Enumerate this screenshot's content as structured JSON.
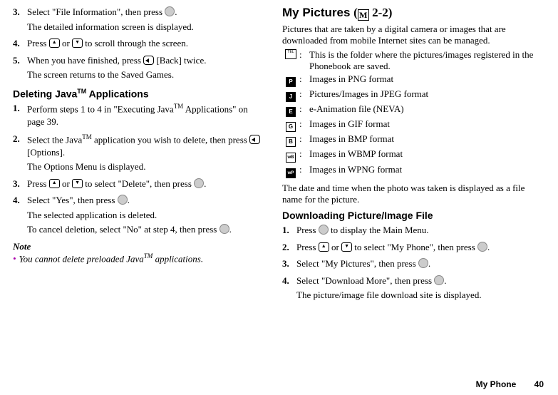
{
  "left": {
    "steps1": [
      {
        "n": "3.",
        "l1": "Select \"File Information\", then press ",
        "after": ".",
        "l2": "The detailed information screen is displayed."
      },
      {
        "n": "4.",
        "l1": "Press ",
        "mid": " or ",
        "after": " to scroll through the screen."
      },
      {
        "n": "5.",
        "l1": "When you have finished, press ",
        "after": " [Back] twice.",
        "l2": "The screen returns to the Saved Games."
      }
    ],
    "h2_1_prefix": "Deleting Java",
    "h2_1_tm": "TM",
    "h2_1_suffix": " Applications",
    "steps2": [
      {
        "n": "1.",
        "plain": "Perform steps 1 to 4 in \"Executing Java",
        "tm": "TM",
        "plain2": " Applications\" on page 39."
      },
      {
        "n": "2.",
        "l1": "Select the Java",
        "tm": "TM",
        "l1b": " application you wish to delete, then press ",
        "after": " [Options].",
        "l2": "The Options Menu is displayed."
      },
      {
        "n": "3.",
        "l1": "Press ",
        "mid": " or ",
        "l1b": " to select \"Delete\", then press ",
        "after": "."
      },
      {
        "n": "4.",
        "l1": "Select \"Yes\", then press ",
        "after": ".",
        "l2": "The selected application is deleted.",
        "l3": "To cancel deletion, select \"No\" at step 4, then press ",
        "after2": "."
      }
    ],
    "note_head": "Note",
    "note_line_pre": "You cannot delete preloaded Java",
    "note_tm": "TM",
    "note_line_post": " applications."
  },
  "right": {
    "h1": "My Pictures",
    "mbox": "M",
    "mcode": " 2-2)",
    "intro": "Pictures that are taken by a digital camera or images that are downloaded from mobile Internet sites can be managed.",
    "formats": [
      {
        "icon": "TEL",
        "desc": "This is the folder where the pictures/images registered in the Phonebook are saved."
      },
      {
        "icon": "P",
        "desc": "Images in PNG format"
      },
      {
        "icon": "J",
        "desc": "Pictures/Images in JPEG format"
      },
      {
        "icon": "E",
        "desc": "e-Animation file (NEVA)"
      },
      {
        "icon": "G",
        "desc": "Images in GIF format"
      },
      {
        "icon": "B",
        "desc": "Images in BMP format"
      },
      {
        "icon": "wB",
        "desc": "Images in WBMP format"
      },
      {
        "icon": "wP",
        "desc": "Images in WPNG format"
      }
    ],
    "note1": "The date and time when the photo was taken is displayed as a file name for the picture.",
    "h2": "Downloading Picture/Image File",
    "dsteps": [
      {
        "n": "1.",
        "l1": "Press ",
        "after": " to display the Main Menu."
      },
      {
        "n": "2.",
        "l1": "Press ",
        "mid": " or ",
        "l1b": " to select \"My Phone\", then press ",
        "after": "."
      },
      {
        "n": "3.",
        "l1": "Select \"My Pictures\", then press ",
        "after": "."
      },
      {
        "n": "4.",
        "l1": "Select \"Download More\", then press ",
        "after": ".",
        "l2": "The picture/image file download site is displayed."
      }
    ]
  },
  "footer": {
    "section": "My Phone",
    "page": "40"
  }
}
